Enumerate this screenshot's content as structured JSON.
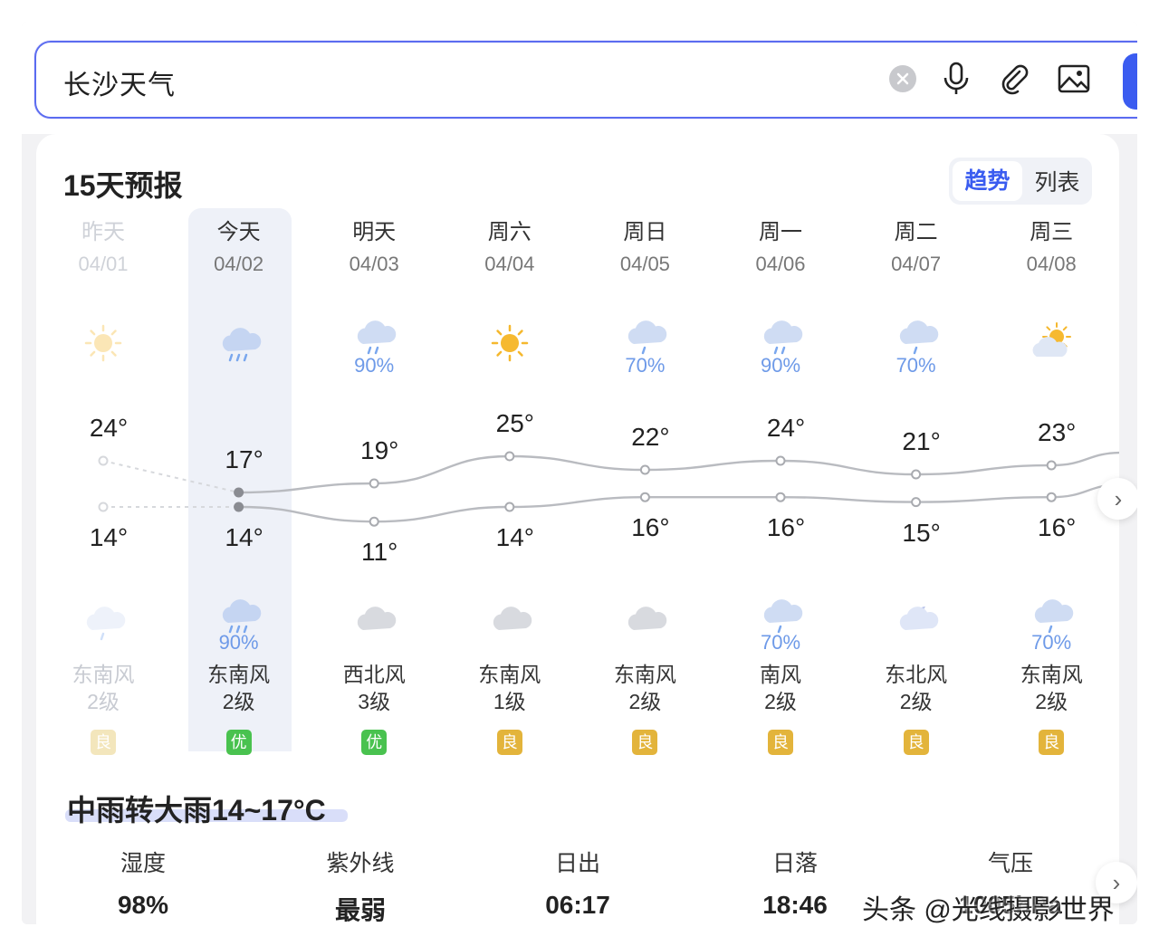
{
  "search": {
    "query": "长沙天气"
  },
  "card": {
    "title": "15天预报",
    "toggle": {
      "trend": "趋势",
      "list": "列表"
    }
  },
  "days": [
    {
      "name": "昨天",
      "date": "04/01",
      "high": "24°",
      "low": "14°",
      "day_icon": "sun-icon",
      "day_pct": "",
      "night_icon": "light-rain-icon",
      "night_pct": "",
      "wind_dir": "东南风",
      "wind_level": "2级",
      "aqi": "良"
    },
    {
      "name": "今天",
      "date": "04/02",
      "high": "17°",
      "low": "14°",
      "day_icon": "heavy-rain-icon",
      "day_pct": "",
      "night_icon": "heavy-rain-icon",
      "night_pct": "90%",
      "wind_dir": "东南风",
      "wind_level": "2级",
      "aqi": "优"
    },
    {
      "name": "明天",
      "date": "04/03",
      "high": "19°",
      "low": "11°",
      "day_icon": "moderate-rain-icon",
      "day_pct": "90%",
      "night_icon": "cloudy-icon",
      "night_pct": "",
      "wind_dir": "西北风",
      "wind_level": "3级",
      "aqi": "优"
    },
    {
      "name": "周六",
      "date": "04/04",
      "high": "25°",
      "low": "14°",
      "day_icon": "sun-icon",
      "day_pct": "",
      "night_icon": "cloudy-icon",
      "night_pct": "",
      "wind_dir": "东南风",
      "wind_level": "1级",
      "aqi": "良"
    },
    {
      "name": "周日",
      "date": "04/05",
      "high": "22°",
      "low": "16°",
      "day_icon": "light-rain-icon",
      "day_pct": "70%",
      "night_icon": "cloudy-icon",
      "night_pct": "",
      "wind_dir": "东南风",
      "wind_level": "2级",
      "aqi": "良"
    },
    {
      "name": "周一",
      "date": "04/06",
      "high": "24°",
      "low": "16°",
      "day_icon": "moderate-rain-icon",
      "day_pct": "90%",
      "night_icon": "light-rain-icon",
      "night_pct": "70%",
      "wind_dir": "南风",
      "wind_level": "2级",
      "aqi": "良"
    },
    {
      "name": "周二",
      "date": "04/07",
      "high": "21°",
      "low": "15°",
      "day_icon": "light-rain-icon",
      "day_pct": "70%",
      "night_icon": "cloudy-moon-icon",
      "night_pct": "",
      "wind_dir": "东北风",
      "wind_level": "2级",
      "aqi": "良"
    },
    {
      "name": "周三",
      "date": "04/08",
      "high": "23°",
      "low": "16°",
      "day_icon": "partly-cloudy-icon",
      "day_pct": "",
      "night_icon": "light-rain-icon",
      "night_pct": "70%",
      "wind_dir": "东南风",
      "wind_level": "2级",
      "aqi": "良"
    }
  ],
  "chart_data": {
    "type": "line",
    "categories": [
      "04/01",
      "04/02",
      "04/03",
      "04/04",
      "04/05",
      "04/06",
      "04/07",
      "04/08"
    ],
    "series": [
      {
        "name": "",
        "values": [
          24,
          17,
          19,
          25,
          22,
          24,
          21,
          23
        ]
      },
      {
        "name": "",
        "values": [
          14,
          14,
          11,
          14,
          16,
          16,
          15,
          16
        ]
      }
    ]
  },
  "summary": {
    "text": "中雨转大雨14~17°C",
    "stats": [
      {
        "label": "湿度",
        "value": "98%"
      },
      {
        "label": "紫外线",
        "value": "最弱"
      },
      {
        "label": "日出",
        "value": "06:17"
      },
      {
        "label": "日落",
        "value": "18:46"
      },
      {
        "label": "气压",
        "value": "1005hPa"
      }
    ]
  },
  "watermark": "头条 @光线摄影世界",
  "colors": {
    "accent": "#3a5cf0",
    "aqi_good": "#e3b43b",
    "aqi_excellent": "#49c24f",
    "rain_pct": "#6e9ae8"
  }
}
